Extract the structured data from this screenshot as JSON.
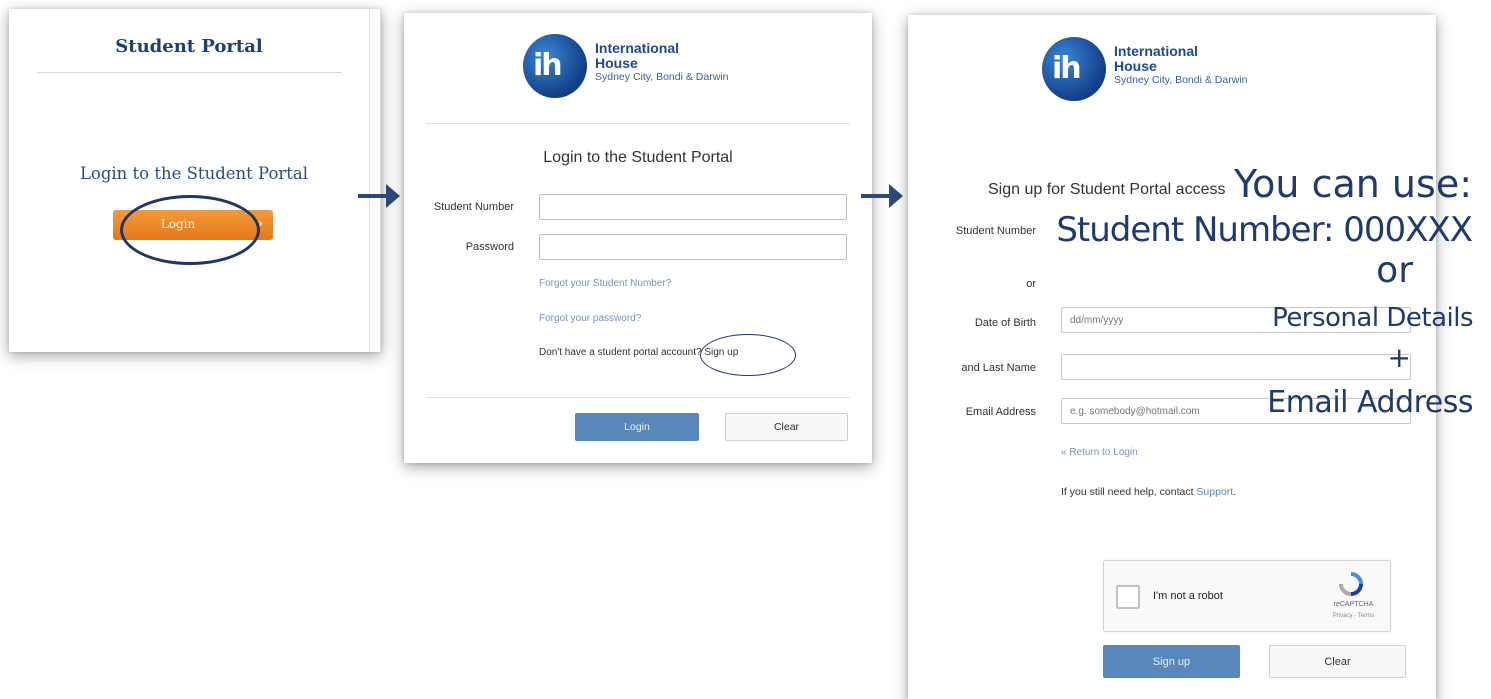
{
  "panel1": {
    "title": "Student Portal",
    "heading": "Login to the Student Portal",
    "login_button": "Login",
    "chevron": "›"
  },
  "panel2": {
    "logo": {
      "mark": "ih",
      "line1": "International",
      "line2": "House",
      "line3": "Sydney City, Bondi & Darwin"
    },
    "heading": "Login to the Student Portal",
    "student_number_label": "Student Number",
    "password_label": "Password",
    "student_number_value": "",
    "password_value": "",
    "forgot_number": "Forgot your Student Number?",
    "forgot_password": "Forgot your password?",
    "no_account": "Don't have a student portal account? Sign up",
    "login_button": "Login",
    "clear_button": "Clear"
  },
  "panel3": {
    "logo": {
      "mark": "ih",
      "line1": "International",
      "line2": "House",
      "line3": "Sydney City, Bondi & Darwin"
    },
    "heading": "Sign up for Student Portal access",
    "student_number_label": "Student Number",
    "or_label": "or",
    "dob_label": "Date of Birth",
    "dob_placeholder": "dd/mm/yyyy",
    "last_name_label": "and Last Name",
    "email_label": "Email Address",
    "email_placeholder": "e.g. somebody@hotmail.com",
    "return_link": "« Return to Login",
    "help_text": "If you still need help, contact ",
    "support_link": "Support",
    "help_end": ".",
    "captcha_label": "I'm not a robot",
    "captcha_brand": "reCAPTCHA",
    "captcha_sub": "Privacy - Terms",
    "signup_button": "Sign up",
    "clear_button": "Clear"
  },
  "annotation": {
    "you_can_use": "You can use:",
    "student_number": "Student Number: 000XXX",
    "or": "or",
    "personal_details": "Personal Details",
    "plus": "+",
    "email_address": "Email Address"
  },
  "colors": {
    "navy": "#1f3a6c",
    "orange": "#e5781a",
    "blue_button": "#5a87bb",
    "link": "#7a94b8"
  },
  "icons": {
    "arrows": "arrow-right-icon",
    "chevron": "chevron-right-icon",
    "captcha": "recaptcha-icon"
  }
}
